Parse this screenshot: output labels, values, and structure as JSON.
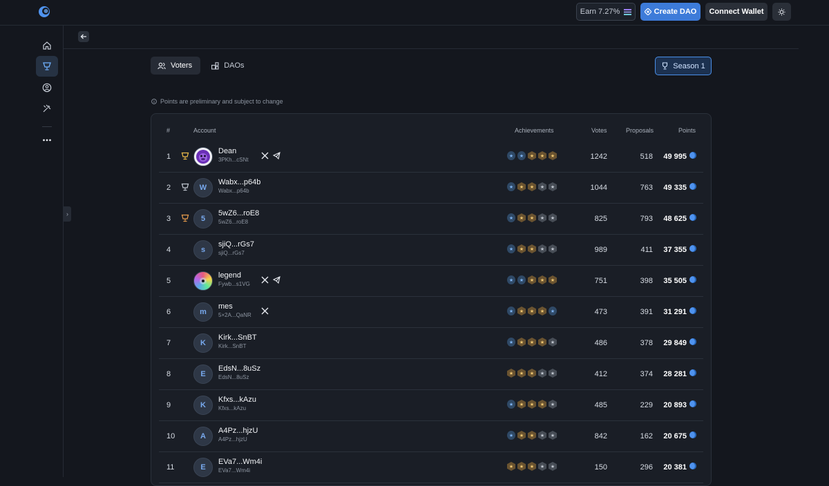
{
  "topbar": {
    "earn_label": "Earn 7.27%",
    "create_dao_label": "Create DAO",
    "connect_wallet_label": "Connect Wallet"
  },
  "tabs": [
    {
      "label": "Voters",
      "icon": "users-icon",
      "active": true
    },
    {
      "label": "DAOs",
      "icon": "dao-icon",
      "active": false
    }
  ],
  "season": {
    "label": "Season 1"
  },
  "notice": "Points are preliminary and subject to change",
  "table": {
    "headers": {
      "rank": "#",
      "account": "Account",
      "achievements": "Achievements",
      "votes": "Votes",
      "proposals": "Proposals",
      "points": "Points"
    },
    "rows": [
      {
        "rank": "1",
        "medal": "gold",
        "avatar": "",
        "avatar_type": "dean",
        "name": "Dean",
        "address": "3PKh...cSNt",
        "x": true,
        "telegram": true,
        "achievements": [
          "blue",
          "blue",
          "gold",
          "gold",
          "gold"
        ],
        "votes": "1242",
        "proposals": "518",
        "points": "49 995"
      },
      {
        "rank": "2",
        "medal": "silver",
        "avatar": "W",
        "avatar_type": "letter",
        "name": "Wabx...p64b",
        "address": "Wabx...p64b",
        "x": false,
        "telegram": false,
        "achievements": [
          "blue",
          "gold",
          "gold",
          "grey",
          "grey"
        ],
        "votes": "1044",
        "proposals": "763",
        "points": "49 335"
      },
      {
        "rank": "3",
        "medal": "bronze",
        "avatar": "5",
        "avatar_type": "letter",
        "name": "5wZ6...roE8",
        "address": "5wZ6...roE8",
        "x": false,
        "telegram": false,
        "achievements": [
          "blue",
          "gold",
          "gold",
          "grey",
          "grey"
        ],
        "votes": "825",
        "proposals": "793",
        "points": "48 625"
      },
      {
        "rank": "4",
        "medal": "",
        "avatar": "s",
        "avatar_type": "letter",
        "name": "sjiQ...rGs7",
        "address": "sjiQ...rGs7",
        "x": false,
        "telegram": false,
        "achievements": [
          "blue",
          "gold",
          "gold",
          "grey",
          "grey"
        ],
        "votes": "989",
        "proposals": "411",
        "points": "37 355"
      },
      {
        "rank": "5",
        "medal": "",
        "avatar": "",
        "avatar_type": "legend",
        "name": "legend",
        "address": "Fywb...s1VG",
        "x": true,
        "telegram": true,
        "achievements": [
          "blue",
          "blue",
          "gold",
          "gold",
          "gold"
        ],
        "votes": "751",
        "proposals": "398",
        "points": "35 505"
      },
      {
        "rank": "6",
        "medal": "",
        "avatar": "m",
        "avatar_type": "letter",
        "name": "mes",
        "address": "5×2A...QaNR",
        "x": true,
        "telegram": false,
        "achievements": [
          "blue",
          "gold",
          "gold",
          "gold",
          "blue"
        ],
        "votes": "473",
        "proposals": "391",
        "points": "31 291"
      },
      {
        "rank": "7",
        "medal": "",
        "avatar": "K",
        "avatar_type": "letter",
        "name": "Kirk...SnBT",
        "address": "Kirk...SnBT",
        "x": false,
        "telegram": false,
        "achievements": [
          "blue",
          "gold",
          "gold",
          "gold",
          "grey"
        ],
        "votes": "486",
        "proposals": "378",
        "points": "29 849"
      },
      {
        "rank": "8",
        "medal": "",
        "avatar": "E",
        "avatar_type": "letter",
        "name": "EdsN...8uSz",
        "address": "EdsN...8uSz",
        "x": false,
        "telegram": false,
        "achievements": [
          "gold",
          "gold",
          "gold",
          "grey",
          "grey"
        ],
        "votes": "412",
        "proposals": "374",
        "points": "28 281"
      },
      {
        "rank": "9",
        "medal": "",
        "avatar": "K",
        "avatar_type": "letter",
        "name": "Kfxs...kAzu",
        "address": "Kfxs...kAzu",
        "x": false,
        "telegram": false,
        "achievements": [
          "blue",
          "gold",
          "gold",
          "gold",
          "grey"
        ],
        "votes": "485",
        "proposals": "229",
        "points": "20 893"
      },
      {
        "rank": "10",
        "medal": "",
        "avatar": "A",
        "avatar_type": "letter",
        "name": "A4Pz...hjzU",
        "address": "A4Pz...hjzU",
        "x": false,
        "telegram": false,
        "achievements": [
          "blue",
          "gold",
          "gold",
          "grey",
          "grey"
        ],
        "votes": "842",
        "proposals": "162",
        "points": "20 675"
      },
      {
        "rank": "11",
        "medal": "",
        "avatar": "E",
        "avatar_type": "letter",
        "name": "EVa7...Wm4i",
        "address": "EVa7...Wm4i",
        "x": false,
        "telegram": false,
        "achievements": [
          "gold",
          "gold",
          "gold",
          "grey",
          "grey"
        ],
        "votes": "150",
        "proposals": "296",
        "points": "20 381"
      }
    ]
  }
}
